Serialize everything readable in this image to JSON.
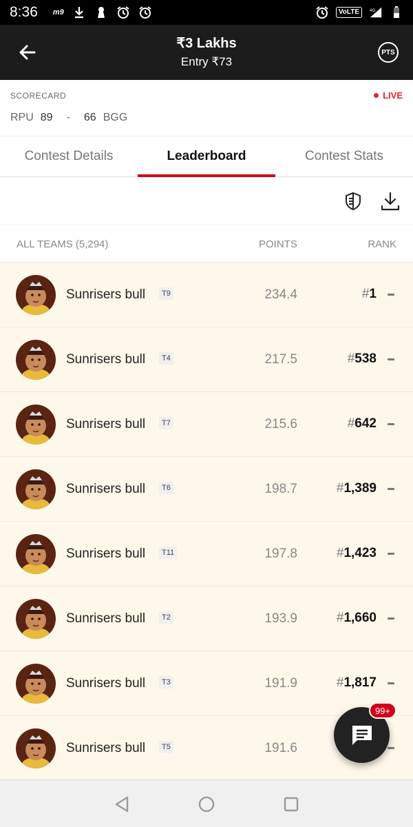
{
  "status_bar": {
    "time": "8:36",
    "left_icons": [
      "mygov-icon",
      "download-icon",
      "keyhole-icon",
      "alarm-icon",
      "alarm-icon"
    ],
    "carrier_text": "VoLTE",
    "network": "4G"
  },
  "header": {
    "title": "₹3 Lakhs",
    "subtitle": "Entry ₹73",
    "pts_label": "PTS"
  },
  "scorecard": {
    "label": "SCORECARD",
    "live_label": "LIVE",
    "team1": "RPU",
    "score1": "89",
    "separator": "-",
    "score2": "66",
    "team2": "BGG"
  },
  "tabs": [
    {
      "label": "Contest Details",
      "active": false
    },
    {
      "label": "Leaderboard",
      "active": true
    },
    {
      "label": "Contest Stats",
      "active": false
    }
  ],
  "columns": {
    "teams": "ALL TEAMS (5,294)",
    "points": "POINTS",
    "rank": "RANK"
  },
  "rows": [
    {
      "name": "Sunrisers bull",
      "team": "T9",
      "points": "234.4",
      "rank": "1"
    },
    {
      "name": "Sunrisers bull",
      "team": "T4",
      "points": "217.5",
      "rank": "538"
    },
    {
      "name": "Sunrisers bull",
      "team": "T7",
      "points": "215.6",
      "rank": "642"
    },
    {
      "name": "Sunrisers bull",
      "team": "T6",
      "points": "198.7",
      "rank": "1,389"
    },
    {
      "name": "Sunrisers bull",
      "team": "T11",
      "points": "197.8",
      "rank": "1,423"
    },
    {
      "name": "Sunrisers bull",
      "team": "T2",
      "points": "193.9",
      "rank": "1,660"
    },
    {
      "name": "Sunrisers bull",
      "team": "T3",
      "points": "191.9",
      "rank": "1,817"
    },
    {
      "name": "Sunrisers bull",
      "team": "T5",
      "points": "191.6",
      "rank": ""
    }
  ],
  "rank_prefix": "#",
  "chat": {
    "badge": "99+"
  },
  "colors": {
    "accent": "#d0021b",
    "header_bg": "#1c1c1c",
    "row_bg": "#fdf8ea",
    "live": "#e5222c"
  }
}
